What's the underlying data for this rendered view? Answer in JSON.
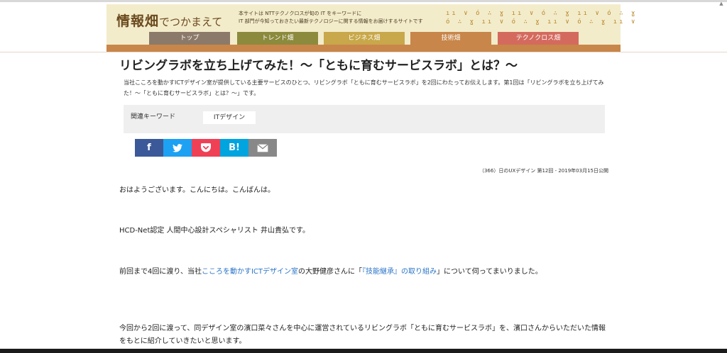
{
  "site": {
    "logo_main": "情報畑",
    "logo_sub": "でつかまえて",
    "tagline_1": "本サイトは NTTテクノクロスが旬の IT をキーワードに",
    "tagline_2": "IT 部門が今知っておきたい最新テクノロジーに関する情報をお届けするサイトです",
    "deco_row_1": "ıı ∨ ó ∴ ɣ ıı ∨ ó ∴ ɣ ıı ∨ ó ∴ ɣ",
    "deco_row_2": "ó ∴ ɣ ıı ∨ ó ∴ ɣ ıı ∨ ó ∴ ɣ ıı ∨"
  },
  "nav": {
    "tabs": [
      {
        "label": "トップ",
        "color": "#8b7a6a"
      },
      {
        "label": "トレンド畑",
        "color": "#8c8a3c"
      },
      {
        "label": "ビジネス畑",
        "color": "#c8a84a"
      },
      {
        "label": "技術畑",
        "color": "#c8864a"
      },
      {
        "label": "テクノクロス畑",
        "color": "#d46a5e"
      }
    ]
  },
  "article": {
    "title": "リビングラボを立ち上げてみた！～「ともに育むサービスラボ」とは？～",
    "lead": "当社こころを動かすICTデザイン室が提供している主要サービスのひとつ、リビングラボ「ともに育むサービスラボ」を2回にわたってお伝えします。第1回は「リビングラボを立ち上げてみた！～「ともに育むサービスラボ」とは？～」です。",
    "keyword_label": "関連キーワード",
    "keyword_tag": "ITデザイン",
    "meta": "（366）日のUXデザイン 第12回 - 2019年03月15日公開",
    "p1": "おはようございます。こんにちは。こんばんは。",
    "p2": "HCD-Net認定 人間中心設計スペシャリスト 井山貴弘です。",
    "p3_pre": "前回まで4回に渡り、当社",
    "p3_link1": "こころを動かすICTデザイン室",
    "p3_mid": "の大野健彦さんに「",
    "p3_link2": "『技能継承』の取り組み",
    "p3_post": "」について伺ってまいりました。",
    "p4": "今回から2回に渡って、同デザイン室の濱口菜々さんを中心に運営されているリビングラボ「ともに育むサービスラボ」を、濱口さんからいただいた情報をもとに紹介していきたいと思います。"
  },
  "share": [
    {
      "icon": "facebook-icon",
      "color": "#3b5998",
      "glyph": "f"
    },
    {
      "icon": "twitter-icon",
      "color": "#1da1f2",
      "glyph": ""
    },
    {
      "icon": "pocket-icon",
      "color": "#ef4056",
      "glyph": ""
    },
    {
      "icon": "hatena-bookmark-icon",
      "color": "#00a4de",
      "glyph": "B!"
    },
    {
      "icon": "mail-icon",
      "color": "#888888",
      "glyph": ""
    }
  ]
}
